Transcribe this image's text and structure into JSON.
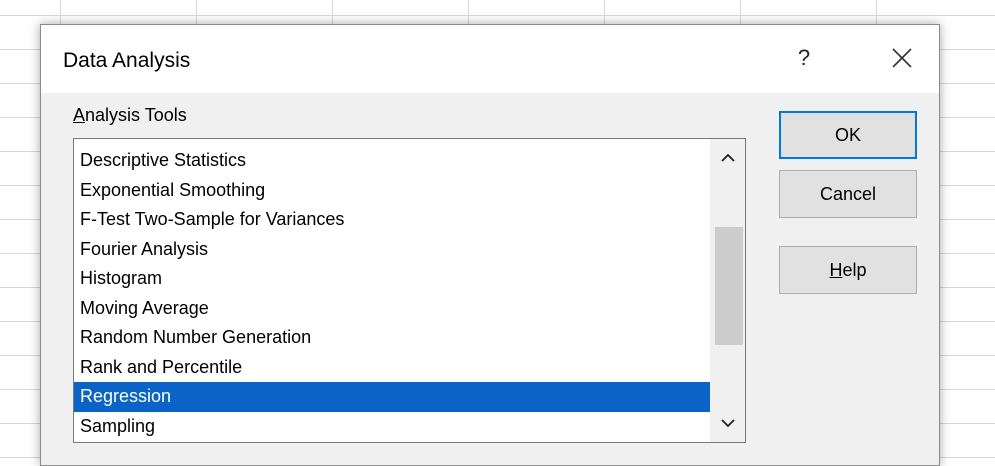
{
  "dialog": {
    "title": "Data Analysis",
    "help_glyph": "?",
    "section_label_accel": "A",
    "section_label_rest": "nalysis Tools",
    "list_items": [
      "Descriptive Statistics",
      "Exponential Smoothing",
      "F-Test Two-Sample for Variances",
      "Fourier Analysis",
      "Histogram",
      "Moving Average",
      "Random Number Generation",
      "Rank and Percentile",
      "Regression",
      "Sampling"
    ],
    "selected_item": "Regression",
    "buttons": {
      "ok_label": "OK",
      "cancel_label": "Cancel",
      "help_accel": "H",
      "help_rest": "elp"
    }
  },
  "colors": {
    "selection": "#0a64c8",
    "default_button_border": "#0078d7",
    "dialog_bg": "#f0f0f0"
  },
  "icons": {
    "close": "close-icon",
    "scroll_up": "chevron-up-icon",
    "scroll_down": "chevron-down-icon"
  }
}
